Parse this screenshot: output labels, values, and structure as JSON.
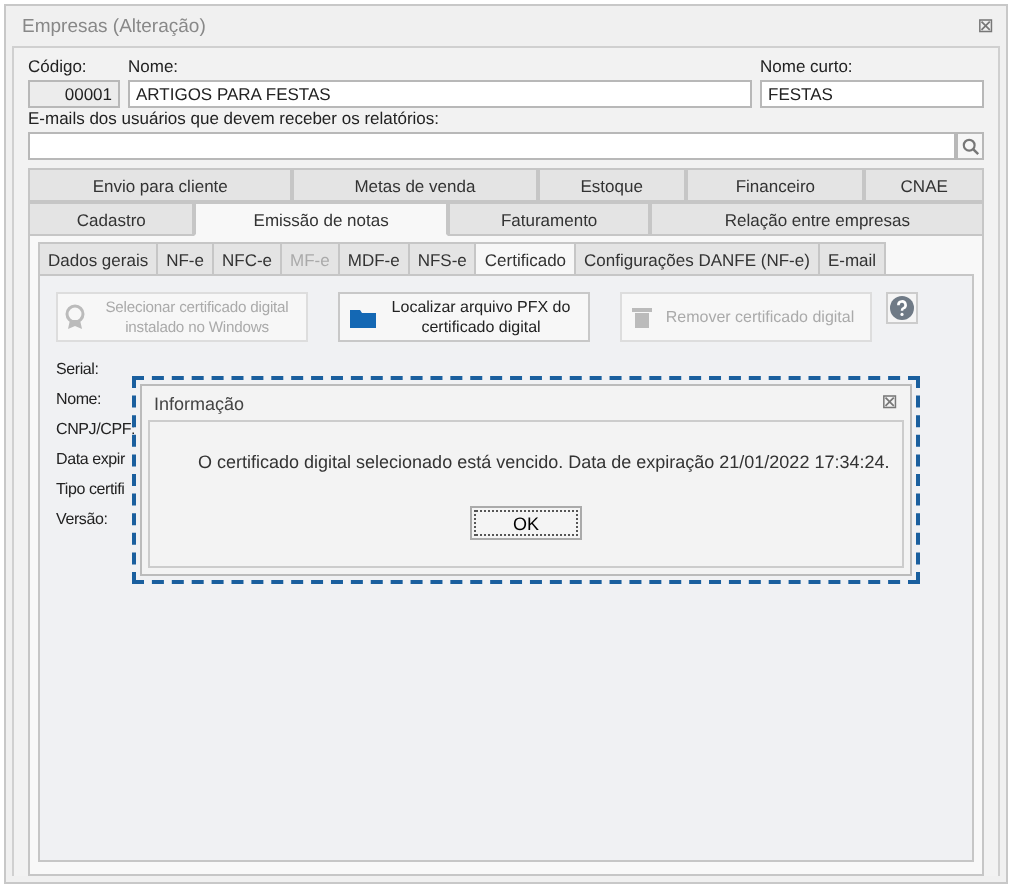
{
  "window": {
    "title": "Empresas (Alteração)",
    "close": "⊠"
  },
  "fields": {
    "codigo": {
      "label": "Código:",
      "value": "00001"
    },
    "nome": {
      "label": "Nome:",
      "value": "ARTIGOS PARA FESTAS"
    },
    "nome_curto": {
      "label": "Nome curto:",
      "value": "FESTAS"
    },
    "emails": {
      "label": "E-mails dos usuários que devem receber os relatórios:"
    }
  },
  "tab_rows": [
    [
      {
        "label": "Envio para cliente",
        "selected": false
      },
      {
        "label": "Metas de venda",
        "selected": false
      },
      {
        "label": "Estoque",
        "selected": false
      },
      {
        "label": "Financeiro",
        "selected": false
      },
      {
        "label": "CNAE",
        "selected": false
      }
    ],
    [
      {
        "label": "Cadastro",
        "selected": false
      },
      {
        "label": "Emissão de notas",
        "selected": true
      },
      {
        "label": "Faturamento",
        "selected": false
      },
      {
        "label": "Relação entre empresas",
        "selected": false
      }
    ]
  ],
  "subtabs": [
    {
      "label": "Dados gerais",
      "selected": false,
      "disabled": false
    },
    {
      "label": "NF-e",
      "selected": false,
      "disabled": false
    },
    {
      "label": "NFC-e",
      "selected": false,
      "disabled": false
    },
    {
      "label": "MF-e",
      "selected": false,
      "disabled": true
    },
    {
      "label": "MDF-e",
      "selected": false,
      "disabled": false
    },
    {
      "label": "NFS-e",
      "selected": false,
      "disabled": false
    },
    {
      "label": "Certificado",
      "selected": true,
      "disabled": false
    },
    {
      "label": "Configurações DANFE (NF-e)",
      "selected": false,
      "disabled": false
    },
    {
      "label": "E-mail",
      "selected": false,
      "disabled": false
    }
  ],
  "actions": [
    {
      "kind": "award",
      "label": "Selecionar certificado digital instalado no Windows",
      "disabled": true
    },
    {
      "kind": "folder",
      "label": "Localizar arquivo PFX do certificado digital",
      "disabled": false
    },
    {
      "kind": "trash",
      "label": "Remover certificado digital",
      "disabled": true
    }
  ],
  "info_labels": [
    "Serial:",
    "Nome:",
    "CNPJ/CPF:",
    "Data expir",
    "Tipo certifi",
    "Versão:"
  ],
  "dialog": {
    "title": "Informação",
    "close": "⊠",
    "message": "O certificado digital selecionado está vencido. Data de expiração 21/01/2022 17:34:24.",
    "button": "OK"
  }
}
